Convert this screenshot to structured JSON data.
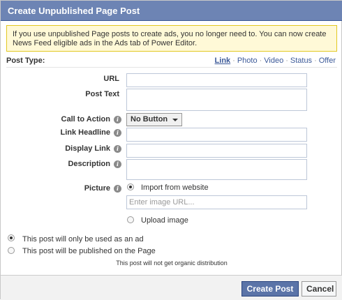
{
  "dialog": {
    "title": "Create Unpublished Page Post"
  },
  "notice": {
    "text": "If you use unpublished Page posts to create ads, you no longer need to. You can now create News Feed eligible ads in the Ads tab of Power Editor."
  },
  "post_type": {
    "label": "Post Type:",
    "tabs": [
      {
        "label": "Link",
        "active": true
      },
      {
        "label": "Photo",
        "active": false
      },
      {
        "label": "Video",
        "active": false
      },
      {
        "label": "Status",
        "active": false
      },
      {
        "label": "Offer",
        "active": false
      }
    ],
    "separator": "·"
  },
  "form": {
    "url_label": "URL",
    "url_value": "",
    "post_text_label": "Post Text",
    "post_text_value": "",
    "cta_label": "Call to Action",
    "cta_value": "No Button",
    "link_headline_label": "Link Headline",
    "link_headline_value": "",
    "display_link_label": "Display Link",
    "display_link_value": "",
    "description_label": "Description",
    "description_value": "",
    "picture_label": "Picture",
    "import_label": "Import from website",
    "image_url_placeholder": "Enter image URL...",
    "upload_label": "Upload image",
    "picture_source_selected": "Import from website"
  },
  "usage": {
    "option_ad_only": "This post will only be used as an ad",
    "option_publish": "This post will be published on the Page",
    "selected": "This post will only be used as an ad",
    "note": "This post will not get organic distribution"
  },
  "footer": {
    "create_label": "Create Post",
    "cancel_label": "Cancel"
  },
  "colors": {
    "titlebar": "#6d84b4",
    "link": "#3b5998",
    "notice_bg": "#fff9d7",
    "primary_button": "#5b74a8"
  },
  "icons": {
    "info": "info-icon",
    "dropdown": "chevron-down-icon"
  }
}
